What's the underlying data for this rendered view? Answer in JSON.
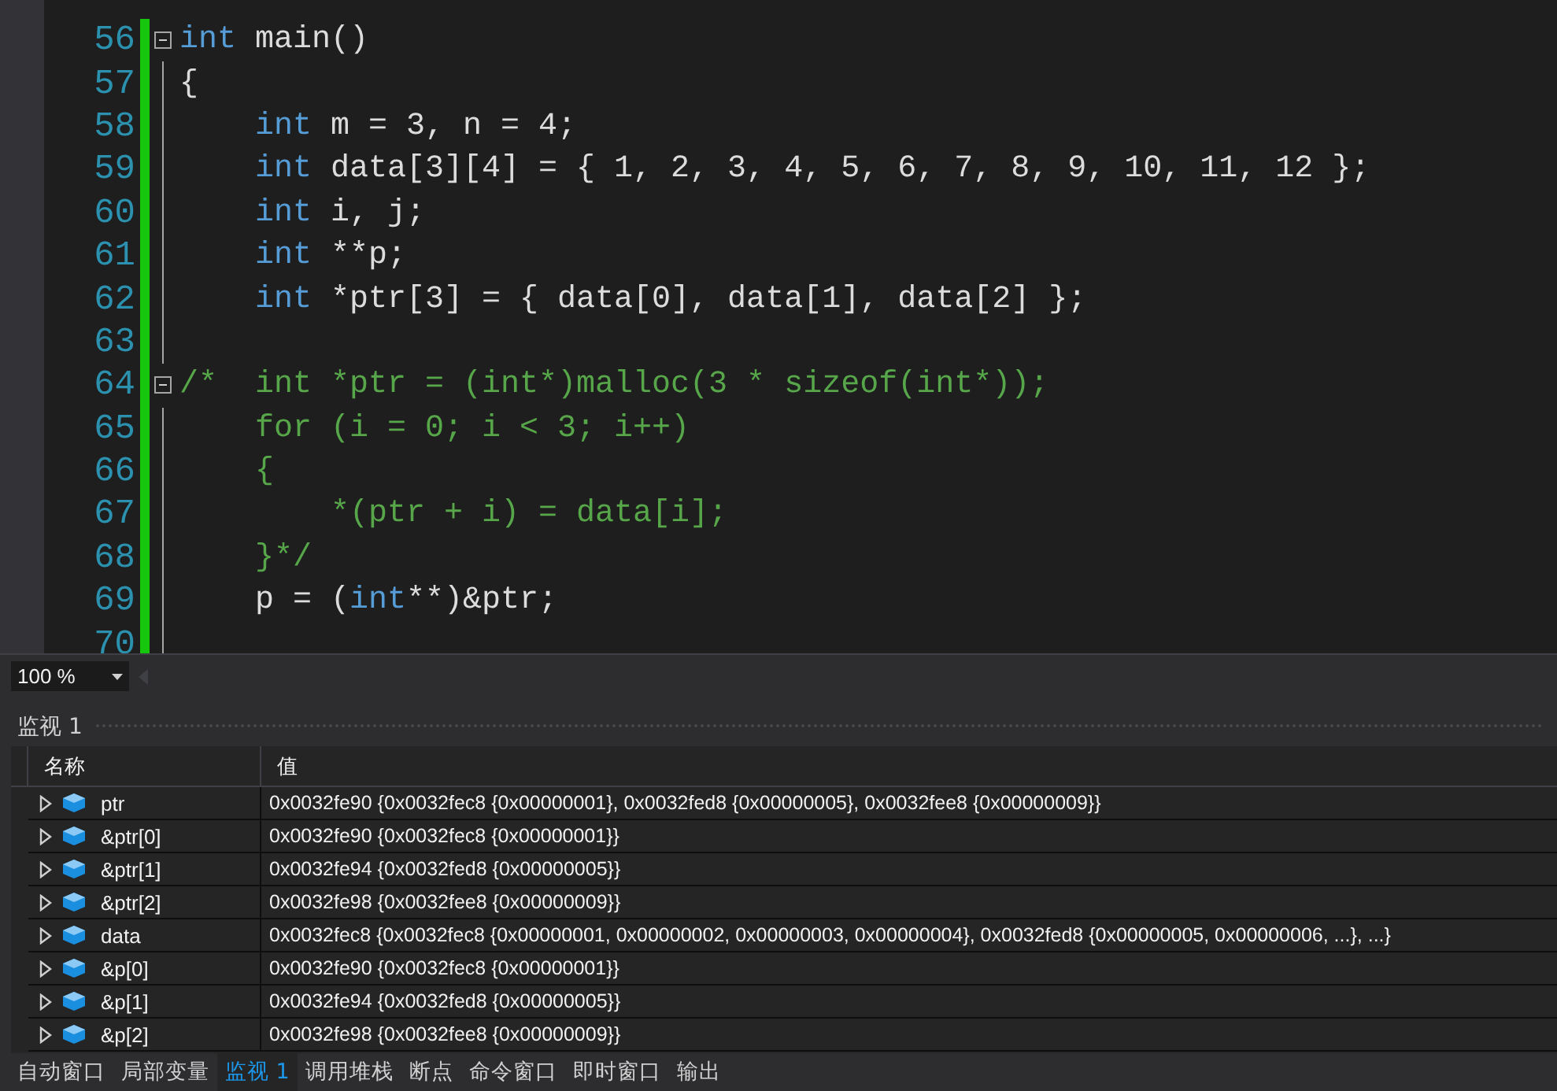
{
  "editor": {
    "zoom": "100 %",
    "lines": [
      {
        "number": "56",
        "fold_start": true,
        "tokens": [
          {
            "kind": "keyword",
            "text": "int"
          },
          {
            "kind": "plain",
            "text": " main()"
          }
        ]
      },
      {
        "number": "57",
        "fold_start": false,
        "tokens": [
          {
            "kind": "plain",
            "text": "{"
          }
        ]
      },
      {
        "number": "58",
        "fold_start": false,
        "tokens": [
          {
            "kind": "keyword",
            "text": "    int"
          },
          {
            "kind": "plain",
            "text": " m = 3, n = 4;"
          }
        ]
      },
      {
        "number": "59",
        "fold_start": false,
        "tokens": [
          {
            "kind": "keyword",
            "text": "    int"
          },
          {
            "kind": "plain",
            "text": " data[3][4] = { 1, 2, 3, 4, 5, 6, 7, 8, 9, 10, 11, 12 };"
          }
        ]
      },
      {
        "number": "60",
        "fold_start": false,
        "tokens": [
          {
            "kind": "keyword",
            "text": "    int"
          },
          {
            "kind": "plain",
            "text": " i, j;"
          }
        ]
      },
      {
        "number": "61",
        "fold_start": false,
        "tokens": [
          {
            "kind": "keyword",
            "text": "    int"
          },
          {
            "kind": "plain",
            "text": " **p;"
          }
        ]
      },
      {
        "number": "62",
        "fold_start": false,
        "tokens": [
          {
            "kind": "keyword",
            "text": "    int"
          },
          {
            "kind": "plain",
            "text": " *ptr[3] = { data[0], data[1], data[2] };"
          }
        ]
      },
      {
        "number": "63",
        "fold_start": false
      },
      {
        "number": "64",
        "fold_start": true,
        "tokens": [
          {
            "kind": "comment",
            "text": "/*  int *ptr = (int*)malloc(3 * sizeof(int*));"
          }
        ]
      },
      {
        "number": "65",
        "fold_start": false,
        "tokens": [
          {
            "kind": "comment",
            "text": "    for (i = 0; i < 3; i++)"
          }
        ]
      },
      {
        "number": "66",
        "fold_start": false,
        "tokens": [
          {
            "kind": "comment",
            "text": "    {"
          }
        ]
      },
      {
        "number": "67",
        "fold_start": false,
        "tokens": [
          {
            "kind": "comment",
            "text": "        *(ptr + i) = data[i];"
          }
        ]
      },
      {
        "number": "68",
        "fold_start": false,
        "tokens": [
          {
            "kind": "comment",
            "text": "    }*/"
          }
        ]
      },
      {
        "number": "69",
        "fold_start": false,
        "tokens": [
          {
            "kind": "plain",
            "text": "    p = ("
          },
          {
            "kind": "keyword",
            "text": "int"
          },
          {
            "kind": "plain",
            "text": "**)&ptr;"
          }
        ]
      },
      {
        "number": "70",
        "fold_start": false
      }
    ]
  },
  "watch_panel": {
    "title": "监视 1",
    "columns": [
      "名称",
      "值"
    ],
    "rows": [
      {
        "name": "ptr",
        "value": "0x0032fe90 {0x0032fec8 {0x00000001}, 0x0032fed8 {0x00000005}, 0x0032fee8 {0x00000009}}"
      },
      {
        "name": "&ptr[0]",
        "value": "0x0032fe90 {0x0032fec8 {0x00000001}}"
      },
      {
        "name": "&ptr[1]",
        "value": "0x0032fe94 {0x0032fed8 {0x00000005}}"
      },
      {
        "name": "&ptr[2]",
        "value": "0x0032fe98 {0x0032fee8 {0x00000009}}"
      },
      {
        "name": "data",
        "value": "0x0032fec8 {0x0032fec8 {0x00000001, 0x00000002, 0x00000003, 0x00000004}, 0x0032fed8 {0x00000005, 0x00000006, ...}, ...}"
      },
      {
        "name": "&p[0]",
        "value": "0x0032fe90 {0x0032fec8 {0x00000001}}"
      },
      {
        "name": "&p[1]",
        "value": "0x0032fe94 {0x0032fed8 {0x00000005}}"
      },
      {
        "name": "&p[2]",
        "value": "0x0032fe98 {0x0032fee8 {0x00000009}}"
      }
    ]
  },
  "tabs": [
    {
      "label": "自动窗口",
      "selected": false
    },
    {
      "label": "局部变量",
      "selected": false
    },
    {
      "label": "监视 1",
      "selected": true
    },
    {
      "label": "调用堆栈",
      "selected": false
    },
    {
      "label": "断点",
      "selected": false
    },
    {
      "label": "命令窗口",
      "selected": false
    },
    {
      "label": "即时窗口",
      "selected": false
    },
    {
      "label": "输出",
      "selected": false
    }
  ]
}
